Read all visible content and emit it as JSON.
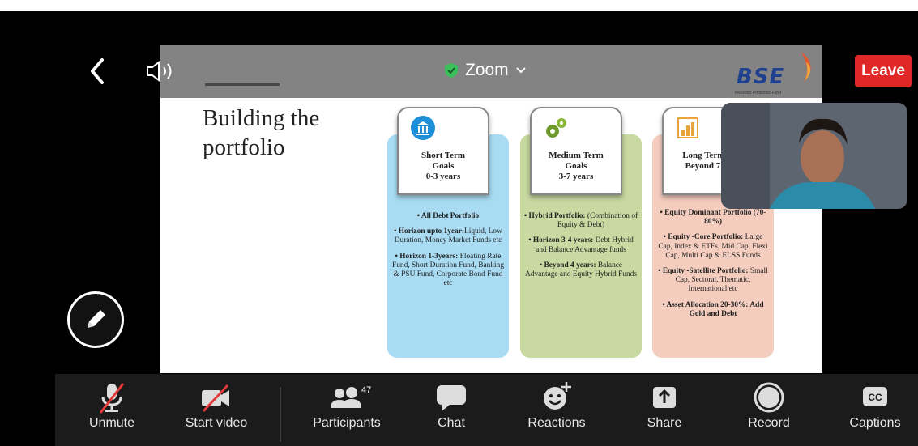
{
  "meeting": {
    "title": "Zoom",
    "leave_label": "Leave"
  },
  "colors": {
    "leave": "#e02828",
    "shield": "#3bbf58",
    "bse_blue": "#1f3f8f",
    "card_blue": "#a9dcf3",
    "card_green": "#c8d9a1",
    "card_pink": "#f5cdbf"
  },
  "slide": {
    "logo": "BSE",
    "logo_sub": "Investors Protection Fund",
    "title": "Building the portfolio",
    "cards": [
      {
        "heading_line1": "Short Term",
        "heading_line2": "Goals",
        "heading_line3": "0-3 years",
        "icon": "bank-icon",
        "items": [
          {
            "bold": "• All Debt Portfolio",
            "text": ""
          },
          {
            "bold": "• Horizon upto 1year:",
            "text": "Liquid, Low Duration, Money Market Funds etc"
          },
          {
            "bold": "• Horizon 1-3years:",
            "text": " Floating Rate Fund, Short Duration Fund, Banking & PSU Fund, Corporate Bond Fund etc"
          }
        ]
      },
      {
        "heading_line1": "Medium Term",
        "heading_line2": "Goals",
        "heading_line3": "3-7 years",
        "icon": "gears-icon",
        "items": [
          {
            "bold": "• Hybrid Portfolio:",
            "text": " (Combination of Equity & Debt)"
          },
          {
            "bold": "• Horizon 3-4 years:",
            "text": " Debt Hybrid and Balance Advantage funds"
          },
          {
            "bold": "• Beyond 4 years:",
            "text": " Balance Advantage and Equity Hybrid Funds"
          }
        ]
      },
      {
        "heading_line1": "Long Term G",
        "heading_line2": "Beyond 7 ye",
        "heading_line3": "",
        "icon": "bar-chart-icon",
        "items": [
          {
            "bold": "• Equity Dominant Portfolio (70-80%)",
            "text": ""
          },
          {
            "bold": "• Equity -Core Portfolio:",
            "text": " Large Cap, Index & ETFs, Mid Cap, Flexi Cap, Multi Cap & ELSS Funds"
          },
          {
            "bold": "• Equity -Satellite Portfolio:",
            "text": " Small Cap, Sectoral, Thematic, International etc"
          },
          {
            "bold": "• Asset Allocation 20-30%: Add Gold and Debt",
            "text": ""
          }
        ]
      }
    ]
  },
  "toolbar": {
    "unmute": "Unmute",
    "start_video": "Start video",
    "participants": "Participants",
    "participants_count": "47",
    "chat": "Chat",
    "reactions": "Reactions",
    "share": "Share",
    "record": "Record",
    "captions": "Captions",
    "captions_icon_text": "CC"
  }
}
